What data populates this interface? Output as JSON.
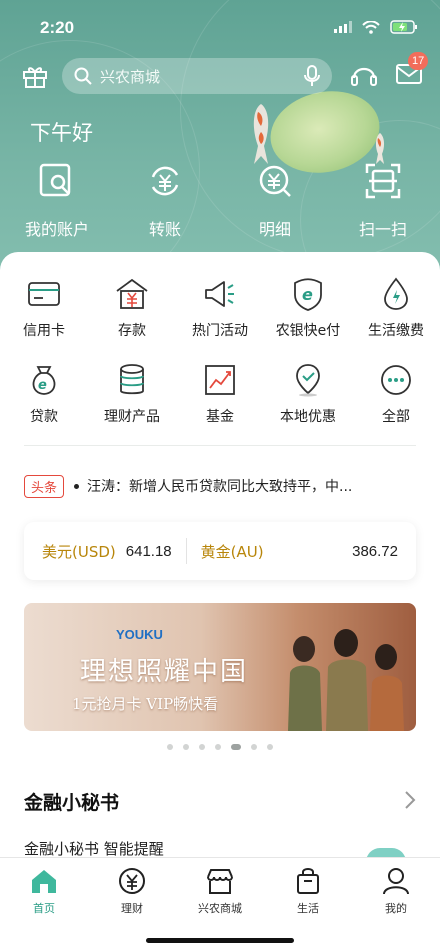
{
  "status_bar": {
    "time": "2:20"
  },
  "header": {
    "search_placeholder": "兴农商城",
    "mail_badge": "17",
    "greeting": "下午好"
  },
  "quick_actions": [
    {
      "label": "我的账户",
      "icon": "account-search-icon"
    },
    {
      "label": "转账",
      "icon": "transfer-icon"
    },
    {
      "label": "明细",
      "icon": "details-icon"
    },
    {
      "label": "扫一扫",
      "icon": "scan-icon"
    }
  ],
  "services": [
    {
      "label": "信用卡",
      "icon": "credit-card-icon"
    },
    {
      "label": "存款",
      "icon": "deposit-icon"
    },
    {
      "label": "热门活动",
      "icon": "megaphone-icon"
    },
    {
      "label": "农银快e付",
      "icon": "e-pay-icon"
    },
    {
      "label": "生活缴费",
      "icon": "water-drop-icon"
    },
    {
      "label": "贷款",
      "icon": "loan-bag-icon"
    },
    {
      "label": "理财产品",
      "icon": "coins-stack-icon"
    },
    {
      "label": "基金",
      "icon": "fund-chart-icon"
    },
    {
      "label": "本地优惠",
      "icon": "location-pin-icon"
    },
    {
      "label": "全部",
      "icon": "more-dots-icon"
    }
  ],
  "news": {
    "tag": "头条",
    "text": "汪涛：新增人民币贷款同比大致持平，中..."
  },
  "rates": {
    "usd_label": "美元(USD)",
    "usd_value": "641.18",
    "gold_label": "黄金(AU)",
    "gold_value": "386.72"
  },
  "banner": {
    "brand": "YOUKU",
    "slogan": "理想照耀中国",
    "sub": "1元抢月卡 VIP畅快看"
  },
  "carousel": {
    "count": 7,
    "active_index": 4
  },
  "finance_secretary": {
    "title": "金融小秘书",
    "subtitle": "金融小秘书 智能提醒"
  },
  "tabs": [
    {
      "label": "首页",
      "icon": "home-icon",
      "active": true
    },
    {
      "label": "理财",
      "icon": "yen-coin-icon",
      "active": false
    },
    {
      "label": "兴农商城",
      "icon": "shop-icon",
      "active": false
    },
    {
      "label": "生活",
      "icon": "shopping-bag-icon",
      "active": false
    },
    {
      "label": "我的",
      "icon": "person-icon",
      "active": false
    }
  ],
  "colors": {
    "brand_green": "#2a9d86",
    "hero": "#6aac9d",
    "news_red": "#e4493d",
    "rate_gold": "#b8860b"
  }
}
